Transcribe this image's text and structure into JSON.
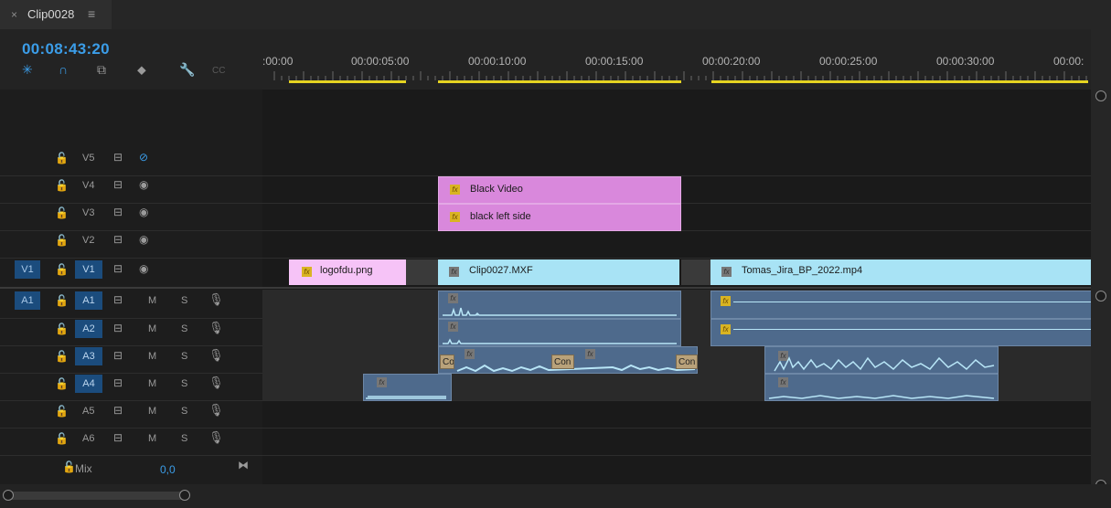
{
  "tab": {
    "close_glyph": "×",
    "title": "Clip0028",
    "menu_glyph": "≡"
  },
  "playhead": {
    "timecode": "00:08:43:20"
  },
  "toolbar": [
    {
      "name": "snap-icon",
      "glyph": "✳",
      "color": "#3b9de8"
    },
    {
      "name": "linked-selection-icon",
      "glyph": "∩",
      "color": "#3b9de8"
    },
    {
      "name": "insert-sequence-icon",
      "glyph": "⧉",
      "color": "#9a9a9a"
    },
    {
      "name": "add-marker-icon",
      "glyph": "⬥",
      "color": "#9a9a9a"
    },
    {
      "name": "wrench-icon",
      "glyph": "🔧",
      "color": "#9a9a9a"
    },
    {
      "name": "captions-icon",
      "glyph": "CC",
      "color": "#5a5a5a"
    }
  ],
  "ruler": {
    "labels": [
      ":00:00",
      "00:00:05:00",
      "00:00:10:00",
      "00:00:15:00",
      "00:00:20:00",
      "00:00:25:00",
      "00:00:30:00",
      "00:00:"
    ]
  },
  "video_tracks": [
    {
      "id": "V5",
      "eye": "hidden"
    },
    {
      "id": "V4",
      "eye": "visible"
    },
    {
      "id": "V3",
      "eye": "visible"
    },
    {
      "id": "V2",
      "eye": "visible"
    },
    {
      "id": "V1",
      "eye": "visible",
      "source": "V1"
    }
  ],
  "audio_tracks": [
    {
      "id": "A1",
      "source": "A1",
      "m": "M",
      "s": "S"
    },
    {
      "id": "A2",
      "m": "M",
      "s": "S"
    },
    {
      "id": "A3",
      "m": "M",
      "s": "S"
    },
    {
      "id": "A4",
      "m": "M",
      "s": "S"
    },
    {
      "id": "A5",
      "m": "M",
      "s": "S"
    },
    {
      "id": "A6",
      "m": "M",
      "s": "S"
    }
  ],
  "mix": {
    "label": "Mix",
    "value": "0,0"
  },
  "clips": {
    "v4": {
      "name": "Black Video",
      "fx": "fx"
    },
    "v3": {
      "name": "black left side",
      "fx": "fx"
    },
    "v1a": {
      "name": "logofdu.png",
      "fx": "fx"
    },
    "v1b": {
      "name": "Clip0027.MXF",
      "fx": "fx"
    },
    "v1c": {
      "name": "Tomas_Jira_BP_2022.mp4",
      "fx": "fx"
    },
    "transitions": [
      "Co",
      "Con",
      "Con"
    ]
  },
  "colors": {
    "accent": "#3b9de8",
    "work_area": "#e5d321",
    "video_pink": "#d988dc",
    "video_cyan": "#a8e3f5",
    "audio_blue": "#4e6a8c",
    "fx_badge": "#d9b422"
  }
}
